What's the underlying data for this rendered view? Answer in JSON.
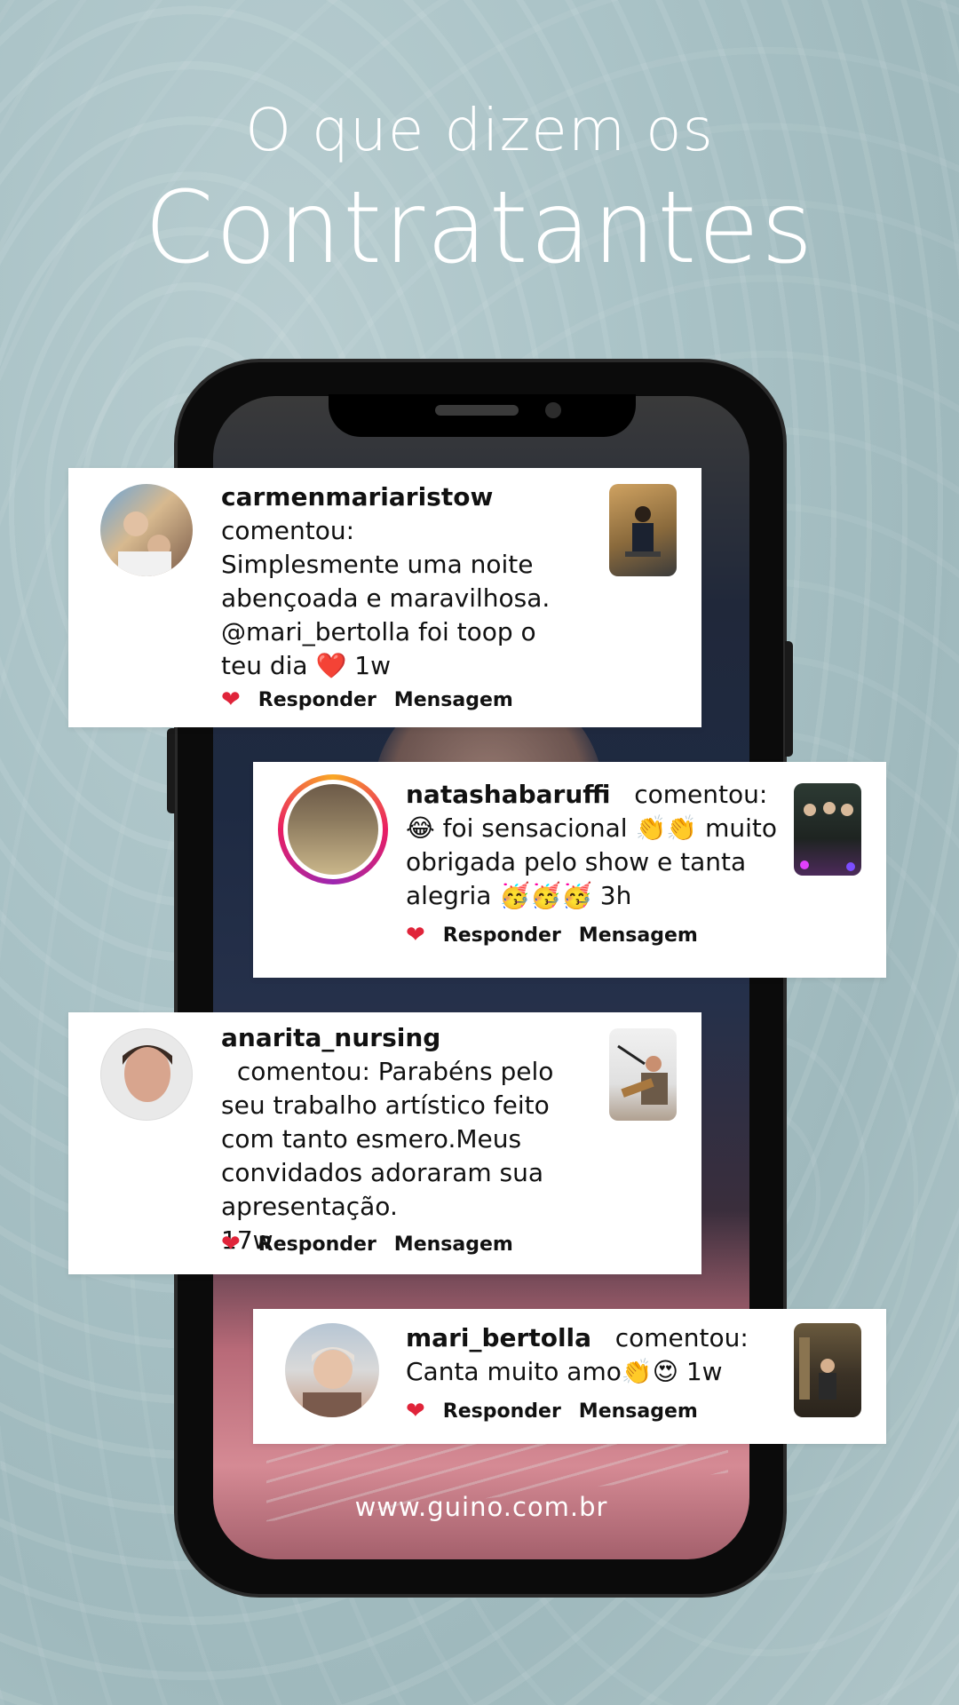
{
  "header": {
    "line1": "O que dizem os",
    "line2": "Contratantes"
  },
  "footer": {
    "url": "www.guino.com.br"
  },
  "colors": {
    "background": "#a9c2c6",
    "heart": "#e0243a",
    "card": "#ffffff"
  },
  "comments": [
    {
      "username": "carmenmariaristow",
      "verb": "comentou:",
      "text": "Simplesmente uma noite abençoada e maravilhosa. @mari_bertolla foi toop o teu dia",
      "emoji": "❤️",
      "time": "1w",
      "reply": "Responder",
      "message": "Mensagem"
    },
    {
      "username": "natashabaruffi",
      "verb": "comentou:",
      "text": "😂 foi sensacional 👏👏 muito obrigada pelo show e tanta alegria 🥳🥳🥳",
      "time": "3h",
      "reply": "Responder",
      "message": "Mensagem"
    },
    {
      "username": "anarita_nursing",
      "verb": "comentou:",
      "text": "Parabéns pelo seu trabalho artístico feito com tanto esmero.Meus convidados adoraram sua apresentação.",
      "time": "17w",
      "reply": "Responder",
      "message": "Mensagem"
    },
    {
      "username": "mari_bertolla",
      "verb": "comentou:",
      "text": "Canta muito amo👏😍",
      "time": "1w",
      "reply": "Responder",
      "message": "Mensagem"
    }
  ],
  "icons": {
    "like": "heart-icon"
  }
}
